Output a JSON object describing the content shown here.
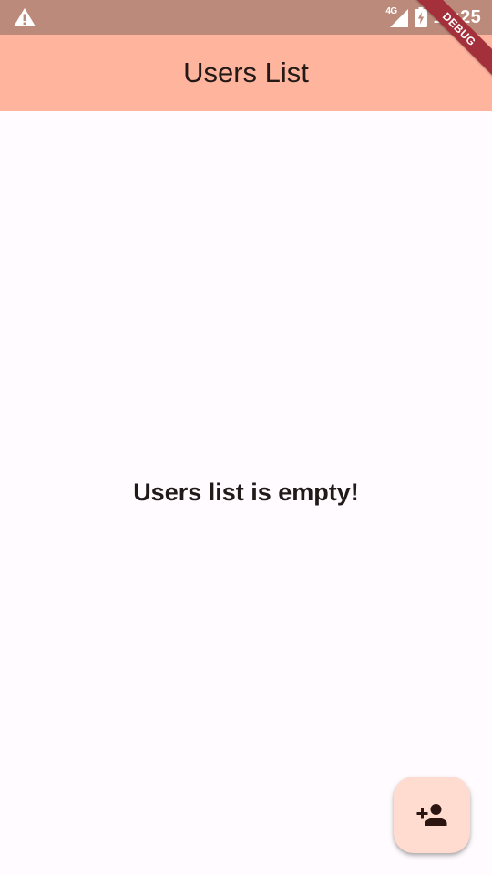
{
  "status_bar": {
    "warning_icon": "warning-icon",
    "network_label": "4G",
    "signal_icon": "signal-icon",
    "battery_icon": "battery-charging-icon",
    "time": "12:25",
    "color": "#bc8a7a"
  },
  "debug_banner": {
    "label": "DEBUG",
    "color": "#a3303a"
  },
  "app_bar": {
    "title": "Users List",
    "color": "#ffb59d"
  },
  "main": {
    "empty_message": "Users list is empty!"
  },
  "fab": {
    "icon": "person-add-icon",
    "color": "#ffdbd0"
  }
}
